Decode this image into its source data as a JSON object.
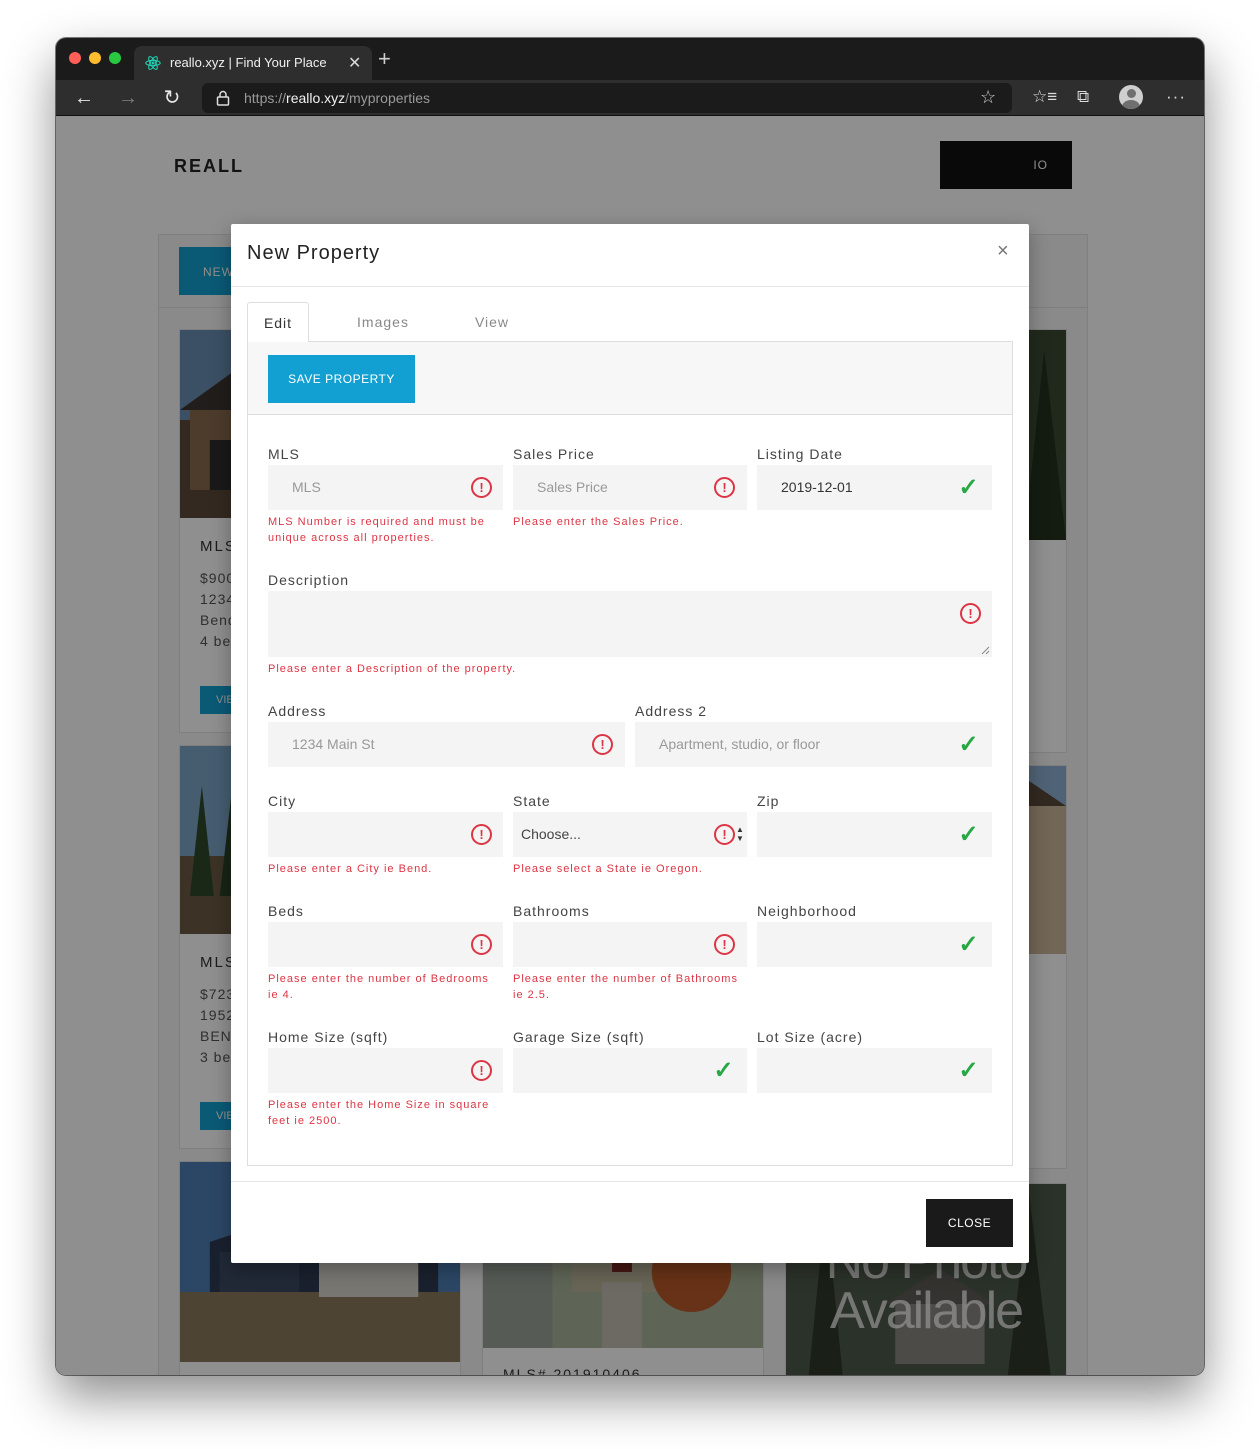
{
  "browser": {
    "tab_title": "reallo.xyz | Find Your Place",
    "url_scheme": "https://",
    "url_host": "reallo.xyz",
    "url_path": "/myproperties",
    "icons": [
      "back-arrow-icon",
      "forward-arrow-icon",
      "reload-icon",
      "lock-icon",
      "favorite-star-icon",
      "favorites-list-icon",
      "collections-icon",
      "profile-avatar-icon",
      "more-menu-icon"
    ]
  },
  "page": {
    "brand": "REALL",
    "portfolio_button": "IO",
    "new_button": "NEW",
    "cards": [
      {
        "mls": "MLS",
        "lines": [
          "$900",
          "1234",
          "Bend",
          "4 be"
        ],
        "view": "VIE"
      },
      {
        "mls": "MLS",
        "lines": [
          "$723",
          "1952",
          "BEN",
          "3 be"
        ],
        "view": "VIE"
      }
    ],
    "bottom_card_mls": "MLS# 201910406",
    "no_photo_text": [
      "No Photo",
      "Available"
    ]
  },
  "modal": {
    "title": "New Property",
    "close_x": "×",
    "tabs": [
      {
        "label": "Edit",
        "active": true
      },
      {
        "label": "Images",
        "active": false
      },
      {
        "label": "View",
        "active": false
      }
    ],
    "save_button": "SAVE PROPERTY",
    "close_button": "CLOSE",
    "colors": {
      "accent": "#12a0d2",
      "error": "#dc3545",
      "valid": "#28a745"
    },
    "fields": {
      "mls": {
        "label": "MLS",
        "placeholder": "MLS",
        "value": "",
        "state": "error",
        "error": "MLS Number is required and must be unique across all properties."
      },
      "sales_price": {
        "label": "Sales Price",
        "placeholder": "Sales Price",
        "value": "",
        "state": "error",
        "error": "Please enter the Sales Price."
      },
      "listing_date": {
        "label": "Listing Date",
        "value": "2019-12-01",
        "state": "valid"
      },
      "description": {
        "label": "Description",
        "value": "",
        "state": "error",
        "error": "Please enter a Description of the property."
      },
      "address": {
        "label": "Address",
        "placeholder": "1234 Main St",
        "value": "",
        "state": "error"
      },
      "address2": {
        "label": "Address 2",
        "placeholder": "Apartment, studio, or floor",
        "value": "",
        "state": "valid"
      },
      "city": {
        "label": "City",
        "value": "",
        "state": "error",
        "error": "Please enter a City ie Bend."
      },
      "state": {
        "label": "State",
        "selected": "Choose...",
        "state": "error",
        "error": "Please select a State ie Oregon."
      },
      "zip": {
        "label": "Zip",
        "value": "",
        "state": "valid"
      },
      "beds": {
        "label": "Beds",
        "value": "",
        "state": "error",
        "error": "Please enter the number of Bedrooms ie 4."
      },
      "bathrooms": {
        "label": "Bathrooms",
        "value": "",
        "state": "error",
        "error": "Please enter the number of Bathrooms ie 2.5."
      },
      "neighborhood": {
        "label": "Neighborhood",
        "value": "",
        "state": "valid"
      },
      "home_size": {
        "label": "Home Size (sqft)",
        "value": "",
        "state": "error",
        "error": "Please enter the Home Size in square feet ie 2500."
      },
      "garage_size": {
        "label": "Garage Size (sqft)",
        "value": "",
        "state": "valid"
      },
      "lot_size": {
        "label": "Lot Size (acre)",
        "value": "",
        "state": "valid"
      }
    }
  }
}
